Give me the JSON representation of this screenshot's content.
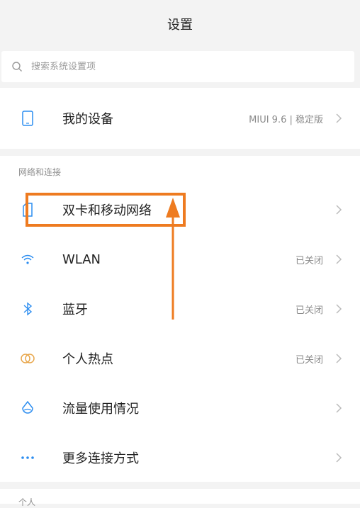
{
  "header": {
    "title": "设置"
  },
  "search": {
    "placeholder": "搜索系统设置项"
  },
  "device": {
    "label": "我的设备",
    "value": "MIUI 9.6 | 稳定版"
  },
  "network_section": {
    "title": "网络和连接",
    "items": [
      {
        "label": "双卡和移动网络",
        "value": "",
        "icon": "sim-card-icon"
      },
      {
        "label": "WLAN",
        "value": "已关闭",
        "icon": "wifi-icon"
      },
      {
        "label": "蓝牙",
        "value": "已关闭",
        "icon": "bluetooth-icon"
      },
      {
        "label": "个人热点",
        "value": "已关闭",
        "icon": "hotspot-icon"
      },
      {
        "label": "流量使用情况",
        "value": "",
        "icon": "data-usage-icon"
      },
      {
        "label": "更多连接方式",
        "value": "",
        "icon": "more-dots-icon"
      }
    ]
  },
  "personal_section": {
    "title": "个人"
  },
  "colors": {
    "highlight": "#ee7b20",
    "accent": "#2c8df0"
  }
}
